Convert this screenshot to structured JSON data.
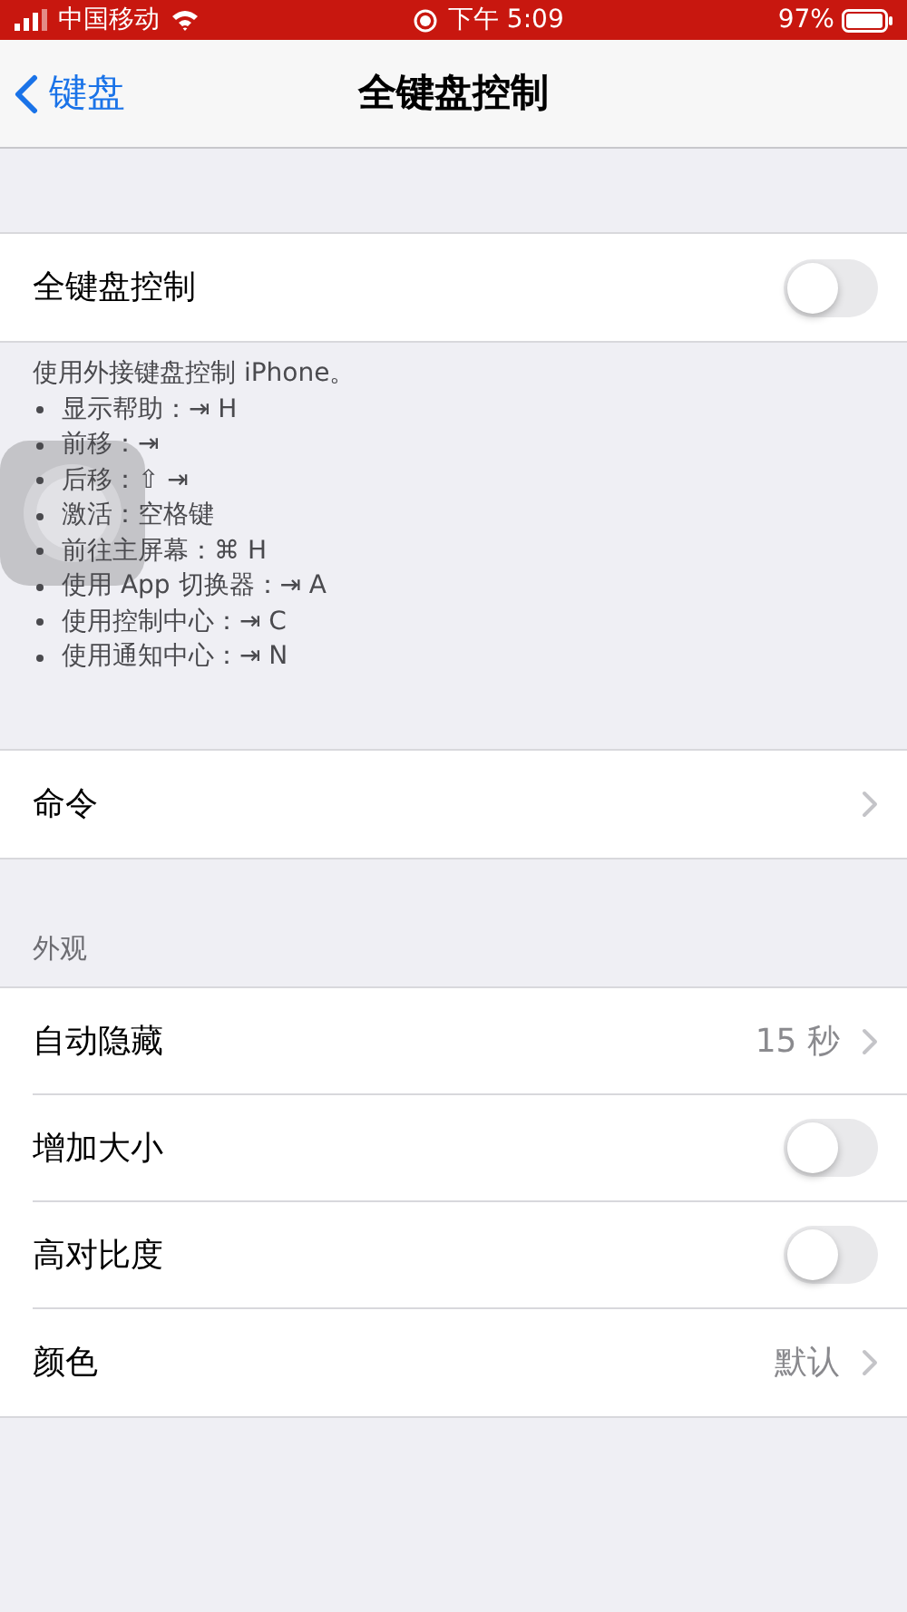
{
  "status_bar": {
    "carrier": "中国移动",
    "time": "下午 5:09",
    "battery": "97%"
  },
  "nav": {
    "back": "键盘",
    "title": "全键盘控制"
  },
  "main_group": {
    "rows": [
      {
        "kind": "toggle",
        "label": "全键盘控制",
        "on": false
      }
    ],
    "footer": {
      "intro": "使用外接键盘控制 iPhone。",
      "items": [
        "显示帮助：⇥ H",
        "前移：⇥",
        "后移：⇧ ⇥",
        "激活：空格键",
        "前往主屏幕：⌘ H",
        "使用 App 切换器：⇥ A",
        "使用控制中心：⇥ C",
        "使用通知中心：⇥ N"
      ]
    }
  },
  "commands_group": {
    "rows": [
      {
        "kind": "disclosure",
        "label": "命令"
      }
    ]
  },
  "appearance_group": {
    "header": "外观",
    "rows": [
      {
        "kind": "disclosure",
        "label": "自动隐藏",
        "value": "15 秒"
      },
      {
        "kind": "toggle",
        "label": "增加大小",
        "on": false
      },
      {
        "kind": "toggle",
        "label": "高对比度",
        "on": false
      },
      {
        "kind": "disclosure",
        "label": "颜色",
        "value": "默认"
      }
    ]
  },
  "assistive_touch": {
    "kind": "floating-button"
  }
}
